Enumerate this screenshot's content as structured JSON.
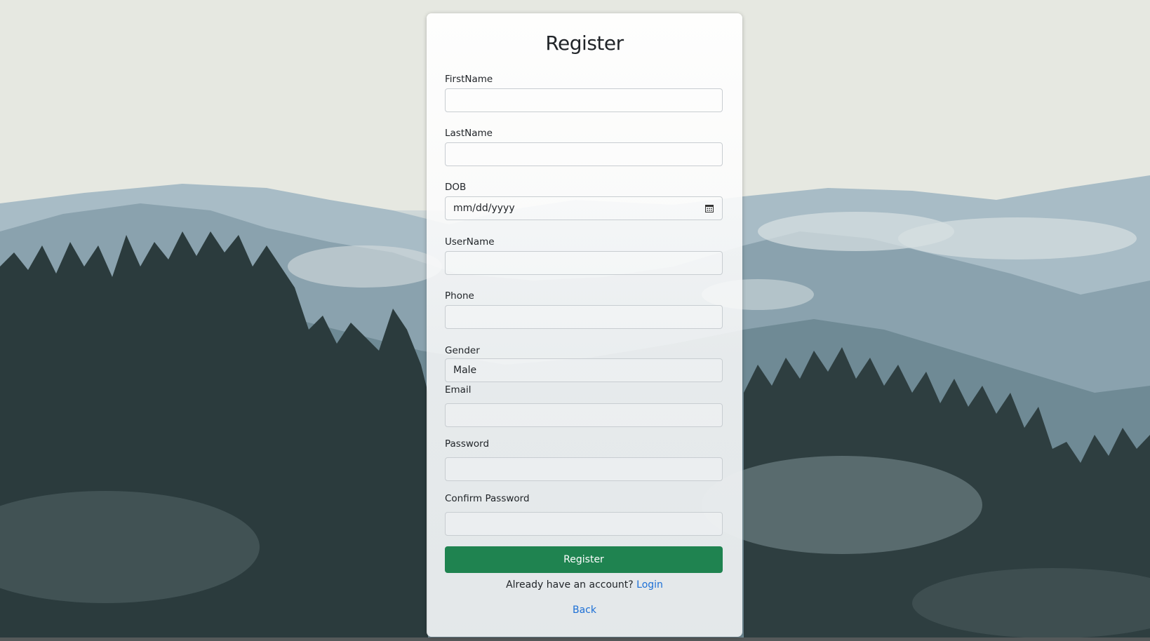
{
  "form": {
    "title": "Register",
    "fields": [
      {
        "label": "FirstName",
        "value": ""
      },
      {
        "label": "LastName",
        "value": ""
      },
      {
        "label": "DOB",
        "value": "mm/dd/yyyy"
      },
      {
        "label": "UserName",
        "value": ""
      },
      {
        "label": "Phone",
        "value": ""
      },
      {
        "label": "Gender",
        "value": "Male"
      },
      {
        "label": "Email",
        "value": ""
      },
      {
        "label": "Password",
        "value": ""
      },
      {
        "label": "Confirm Password",
        "value": ""
      }
    ],
    "submit_label": "Register",
    "account_prompt": "Already have an account?",
    "login_link": "Login",
    "back_link": "Back"
  },
  "icons": {
    "dob_picker": "calendar-icon"
  },
  "colors": {
    "primary_button": "#1f8350",
    "link": "#1c6fd6"
  }
}
